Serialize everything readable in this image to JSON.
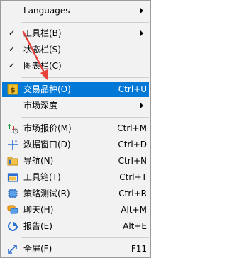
{
  "menu": {
    "items": [
      {
        "label": "Languages",
        "shortcut": "",
        "checked": false,
        "icon": "",
        "submenu": true
      },
      {
        "label": "工具栏(B)",
        "shortcut": "",
        "checked": true,
        "icon": "",
        "submenu": true
      },
      {
        "label": "状态栏(S)",
        "shortcut": "",
        "checked": true,
        "icon": "",
        "submenu": false
      },
      {
        "label": "图表栏(C)",
        "shortcut": "",
        "checked": true,
        "icon": "",
        "submenu": false
      },
      {
        "label": "交易品种(O)",
        "shortcut": "Ctrl+U",
        "checked": false,
        "icon": "dollar-icon",
        "submenu": false,
        "highlighted": true
      },
      {
        "label": "市场深度",
        "shortcut": "",
        "checked": false,
        "icon": "",
        "submenu": true
      },
      {
        "label": "市场报价(M)",
        "shortcut": "Ctrl+M",
        "checked": false,
        "icon": "market-watch-icon",
        "submenu": false
      },
      {
        "label": "数据窗口(D)",
        "shortcut": "Ctrl+D",
        "checked": false,
        "icon": "crosshair-icon",
        "submenu": false
      },
      {
        "label": "导航(N)",
        "shortcut": "Ctrl+N",
        "checked": false,
        "icon": "folder-icon",
        "submenu": false
      },
      {
        "label": "工具箱(T)",
        "shortcut": "Ctrl+T",
        "checked": false,
        "icon": "toolbox-icon",
        "submenu": false
      },
      {
        "label": "策略测试(R)",
        "shortcut": "Ctrl+R",
        "checked": false,
        "icon": "strategy-tester-icon",
        "submenu": false
      },
      {
        "label": "聊天(H)",
        "shortcut": "Alt+M",
        "checked": false,
        "icon": "chat-icon",
        "submenu": false
      },
      {
        "label": "报告(E)",
        "shortcut": "Alt+E",
        "checked": false,
        "icon": "report-icon",
        "submenu": false
      },
      {
        "label": "全屏(F)",
        "shortcut": "F11",
        "checked": false,
        "icon": "fullscreen-icon",
        "submenu": false
      }
    ],
    "check_mark": "✓"
  },
  "colors": {
    "highlight": "#0078d7",
    "menu_background": "#f2f2f2",
    "annotation_arrow": "#e8403a"
  }
}
